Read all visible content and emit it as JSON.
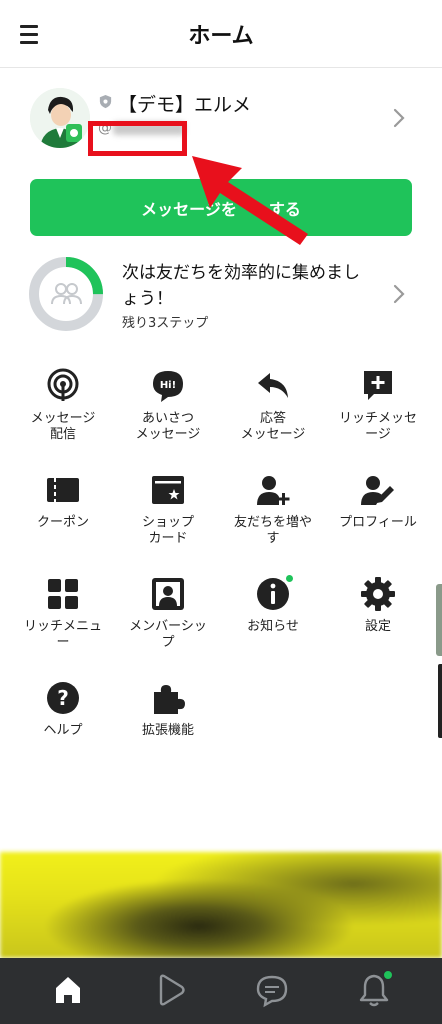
{
  "header": {
    "title": "ホーム",
    "menu_icon": "hamburger-menu-icon"
  },
  "profile": {
    "name": "【デモ】エルメ",
    "id_prefix": "@",
    "id_value_blurred": true,
    "badge_icon": "shield-icon",
    "chevron_icon": "chevron-right-icon"
  },
  "send_button": {
    "label_left": "メッセージを",
    "label_right": "する",
    "color": "#1fc35a"
  },
  "annotation": {
    "box_color": "#e8101c",
    "arrow_color": "#e8101c"
  },
  "steps": {
    "title": "次は友だちを効率的に集めましょう！",
    "subtitle": "残り3ステップ",
    "progress": 0.25,
    "accent": "#1fc35a"
  },
  "menu": {
    "items": [
      {
        "label_lines": [
          "メッセージ",
          "配信"
        ],
        "icon": "broadcast-icon"
      },
      {
        "label_lines": [
          "あいさつ",
          "メッセージ"
        ],
        "icon": "greeting-icon"
      },
      {
        "label_lines": [
          "応答",
          "メッセージ"
        ],
        "icon": "reply-icon"
      },
      {
        "label_lines": [
          "リッチメッセ",
          "ージ"
        ],
        "icon": "rich-message-icon"
      },
      {
        "label_lines": [
          "クーポン"
        ],
        "icon": "coupon-icon"
      },
      {
        "label_lines": [
          "ショップ",
          "カード"
        ],
        "icon": "shop-card-icon"
      },
      {
        "label_lines": [
          "友だちを増や",
          "す"
        ],
        "icon": "add-friend-icon"
      },
      {
        "label_lines": [
          "プロフィール"
        ],
        "icon": "profile-edit-icon"
      },
      {
        "label_lines": [
          "リッチメニュ",
          "ー"
        ],
        "icon": "rich-menu-icon"
      },
      {
        "label_lines": [
          "メンバーシッ",
          "プ"
        ],
        "icon": "membership-icon"
      },
      {
        "label_lines": [
          "お知らせ"
        ],
        "icon": "info-icon",
        "badge": true
      },
      {
        "label_lines": [
          "設定"
        ],
        "icon": "gear-icon"
      },
      {
        "label_lines": [
          "ヘルプ"
        ],
        "icon": "help-icon"
      },
      {
        "label_lines": [
          "拡張機能"
        ],
        "icon": "puzzle-icon"
      }
    ]
  },
  "bottom_nav": {
    "items": [
      {
        "name": "home",
        "icon": "home-icon",
        "active": true
      },
      {
        "name": "voom",
        "icon": "play-icon"
      },
      {
        "name": "chat",
        "icon": "chat-icon"
      },
      {
        "name": "notifications",
        "icon": "bell-icon",
        "badge": true
      }
    ]
  }
}
